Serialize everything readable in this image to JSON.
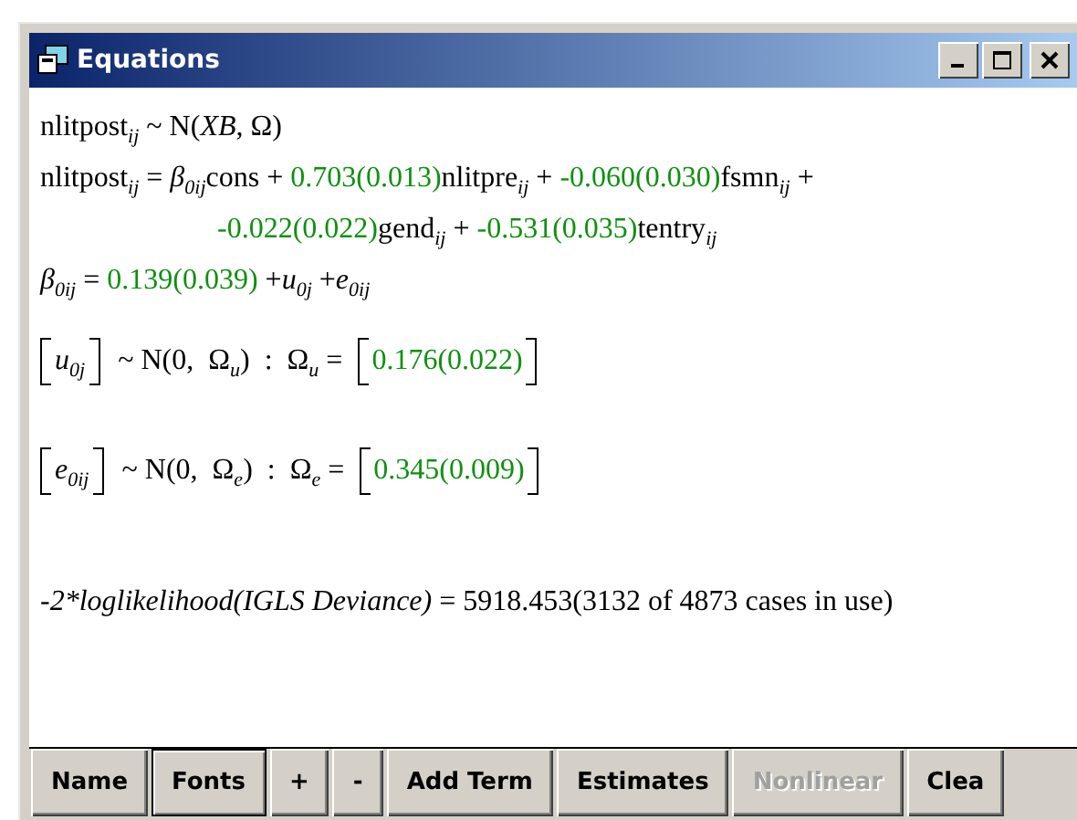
{
  "window": {
    "title": "Equations"
  },
  "lines": [
    {
      "kind": "plain",
      "segments": [
        {
          "kind": "term",
          "text": "nlitpost$_{ij}$ ~ N(*XB*, Ω)"
        }
      ]
    },
    {
      "kind": "plain",
      "segments": [
        {
          "kind": "term",
          "text": "nlitpost$_{ij}$ = *β*$_{0ij}$cons + "
        },
        {
          "kind": "estimate",
          "text": "0.703(0.013)"
        },
        {
          "kind": "term",
          "text": "nlitpre$_{ij}$ + "
        },
        {
          "kind": "estimate",
          "text": "-0.060(0.030)"
        },
        {
          "kind": "term",
          "text": "fsmn$_{ij}$ +"
        }
      ]
    },
    {
      "kind": "continuation",
      "segments": [
        {
          "kind": "estimate",
          "text": "-0.022(0.022)"
        },
        {
          "kind": "term",
          "text": "gend$_{ij}$ + "
        },
        {
          "kind": "estimate",
          "text": "-0.531(0.035)"
        },
        {
          "kind": "term",
          "text": "tentry$_{ij}$"
        }
      ]
    },
    {
      "kind": "plain",
      "segments": [
        {
          "kind": "term",
          "text": "*β*$_{0ij}$ = "
        },
        {
          "kind": "estimate",
          "text": "0.139(0.039)"
        },
        {
          "kind": "term",
          "text": " +*u*$_{0j}$ +*e*$_{0ij}$"
        }
      ]
    },
    {
      "kind": "matrix",
      "segments": [
        {
          "kind": "vector",
          "text": "*u*$_{0j}$"
        },
        {
          "kind": "term",
          "text": "~ N(0,  Ω$_{u}$)  :  Ω$_{u}$ ="
        },
        {
          "kind": "vector-estimate",
          "text": "0.176(0.022)"
        }
      ]
    },
    {
      "kind": "matrix",
      "segments": [
        {
          "kind": "vector",
          "text": "*e*$_{0ij}$"
        },
        {
          "kind": "term",
          "text": "~ N(0,  Ω$_{e}$)  :  Ω$_{e}$ ="
        },
        {
          "kind": "vector-estimate",
          "text": "0.345(0.009)"
        }
      ]
    },
    {
      "kind": "summary",
      "segments": [
        {
          "kind": "italic-term",
          "text": "-2*loglikelihood(IGLS Deviance)"
        },
        {
          "kind": "term",
          "text": " = 5918.453(3132 of 4873 cases in use)"
        }
      ]
    }
  ],
  "buttons": [
    {
      "label": "Name",
      "focused": false,
      "disabled": false
    },
    {
      "label": "Fonts",
      "focused": true,
      "disabled": false
    },
    {
      "label": "+",
      "focused": false,
      "disabled": false
    },
    {
      "label": "-",
      "focused": false,
      "disabled": false
    },
    {
      "label": "Add Term",
      "focused": false,
      "disabled": false
    },
    {
      "label": "Estimates",
      "focused": false,
      "disabled": false
    },
    {
      "label": "Nonlinear",
      "focused": false,
      "disabled": true
    },
    {
      "label": "Clea",
      "focused": false,
      "disabled": false
    }
  ]
}
